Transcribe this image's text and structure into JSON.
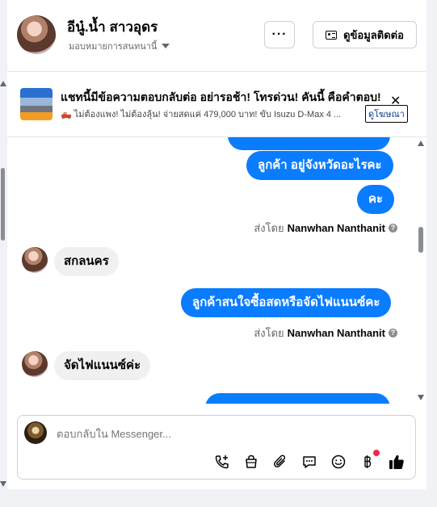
{
  "header": {
    "name": "อีนู๋.น้ำ สาวอุดร",
    "subtitle": "มอบหมายการสนทนานี้",
    "more_label": "···",
    "contact_label": "ดูข้อมูลติดต่อ"
  },
  "ad": {
    "title": "แชทนี้มีข้อความตอบกลับต่อ อย่ารอช้า! โทรด่วน! คันนี้ คือคำตอบ!",
    "description": "🛻 ไม่ต้องแพง! ไม่ต้องลุ้น! จ่ายสดแค่ 479,000 บาท! ขับ Isuzu D-Max 4 ...",
    "link_label": "ดูโฆษณา",
    "close_label": "✕"
  },
  "messages": {
    "out_1": "ลูกค้า อยู่จังหวัดอะไรคะ",
    "out_2": "คะ",
    "sent_by_prefix": "ส่งโดย",
    "agent": "Nanwhan Nanthanit",
    "in_1": "สกลนคร",
    "out_3": "ลูกค้าสนใจซื้อสดหรือจัดไฟแนนซ์คะ",
    "in_2": "จัดไฟแนนซ์ค่ะ"
  },
  "composer": {
    "placeholder": "ตอบกลับใน Messenger..."
  },
  "icons": {
    "call": "phone-plus-icon",
    "shop": "shopping-bag-icon",
    "attach": "paperclip-icon",
    "saved": "chat-bubble-icon",
    "emoji": "smiley-icon",
    "payment": "baht-icon",
    "like": "thumbs-up-icon"
  },
  "colors": {
    "accent": "#0a7cff",
    "notification": "#f02849"
  }
}
